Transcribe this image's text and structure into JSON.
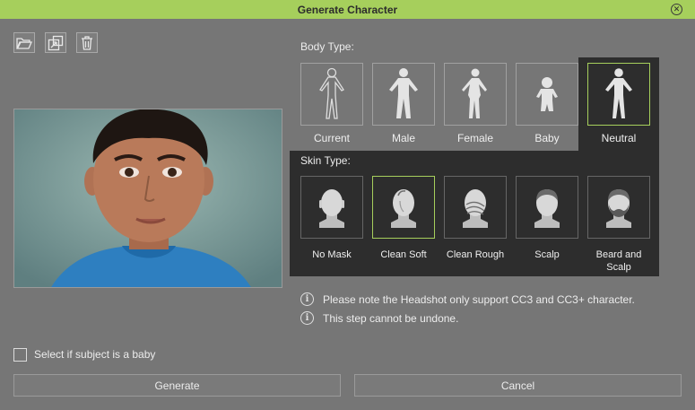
{
  "window": {
    "title": "Generate Character"
  },
  "toolbar": [
    {
      "name": "open-folder-icon"
    },
    {
      "name": "export-image-icon"
    },
    {
      "name": "trash-icon"
    }
  ],
  "body_type": {
    "label": "Body Type:",
    "items": [
      {
        "label": "Current"
      },
      {
        "label": "Male"
      },
      {
        "label": "Female"
      },
      {
        "label": "Baby"
      },
      {
        "label": "Neutral"
      }
    ],
    "selected": "Neutral"
  },
  "skin_type": {
    "label": "Skin Type:",
    "items": [
      {
        "label": "No Mask"
      },
      {
        "label": "Clean Soft"
      },
      {
        "label": "Clean Rough"
      },
      {
        "label": "Scalp"
      },
      {
        "label": "Beard and Scalp"
      }
    ],
    "selected": "Clean Soft"
  },
  "notes": [
    "Please note the Headshot only support CC3 and CC3+ character.",
    "This step cannot be undone."
  ],
  "baby_checkbox": {
    "label": "Select if subject is a baby",
    "checked": false
  },
  "buttons": {
    "generate": "Generate",
    "cancel": "Cancel"
  },
  "colors": {
    "accent": "#a6cf5c",
    "background": "#767676",
    "panel": "#2d2d2d"
  }
}
